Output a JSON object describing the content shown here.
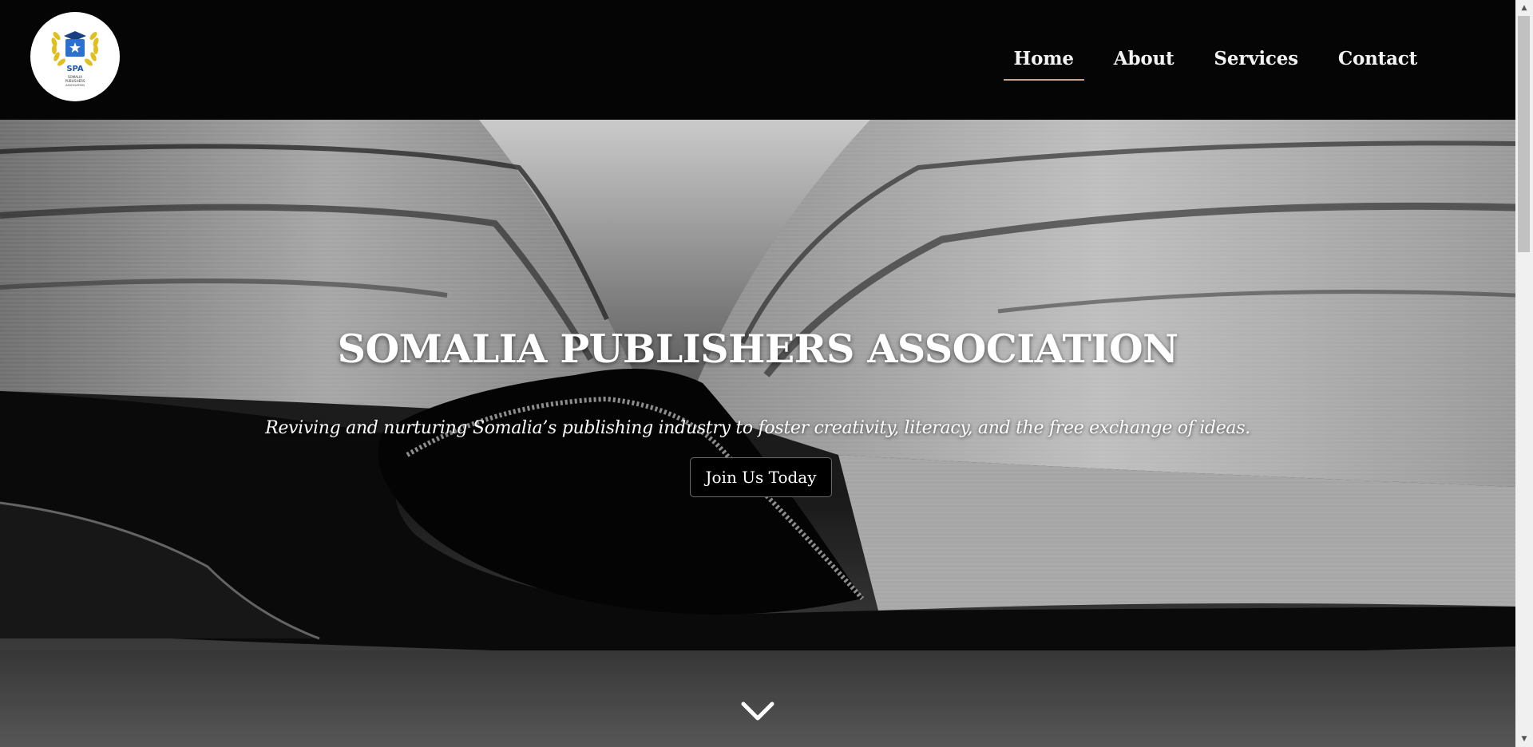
{
  "header": {
    "logo_text": "SPA",
    "logo_subtext": "SOMALIA PUBLISHERS ASSOCIATION",
    "nav": [
      {
        "label": "Home",
        "active": true
      },
      {
        "label": "About",
        "active": false
      },
      {
        "label": "Services",
        "active": false
      },
      {
        "label": "Contact",
        "active": false
      }
    ]
  },
  "hero": {
    "title": "SOMALIA PUBLISHERS ASSOCIATION",
    "tagline": "Reviving and nurturing Somalia’s publishing industry to foster creativity, literacy, and the free exchange of ideas.",
    "cta_label": "Join Us Today",
    "scroll_icon": "chevron-down-icon"
  },
  "colors": {
    "header_bg": "#050505",
    "nav_active_underline": "#c9a38b",
    "button_bg": "#000000",
    "logo_blue": "#1a56b0",
    "logo_gold": "#e0c020"
  }
}
